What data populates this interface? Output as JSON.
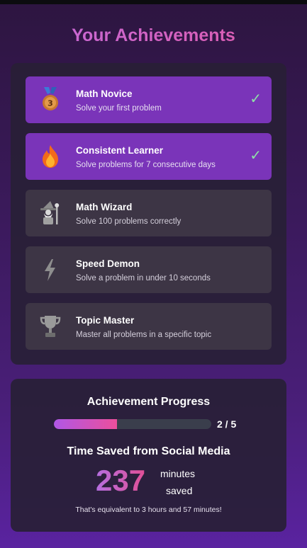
{
  "page": {
    "title": "Your Achievements"
  },
  "achievements": [
    {
      "name": "Math Novice",
      "description": "Solve your first problem",
      "icon": "medal-icon",
      "unlocked": true,
      "check": "✓"
    },
    {
      "name": "Consistent Learner",
      "description": "Solve problems for 7 consecutive days",
      "icon": "fire-icon",
      "unlocked": true,
      "check": "✓"
    },
    {
      "name": "Math Wizard",
      "description": "Solve 100 problems correctly",
      "icon": "wizard-icon",
      "unlocked": false
    },
    {
      "name": "Speed Demon",
      "description": "Solve a problem in under 10 seconds",
      "icon": "lightning-icon",
      "unlocked": false
    },
    {
      "name": "Topic Master",
      "description": "Master all problems in a specific topic",
      "icon": "trophy-icon",
      "unlocked": false
    }
  ],
  "progress": {
    "heading": "Achievement Progress",
    "completed": 2,
    "total": 5,
    "label": "2 / 5",
    "fraction": 0.4
  },
  "time_saved": {
    "heading": "Time Saved from Social Media",
    "value": "237",
    "unit_line1": "minutes",
    "unit_line2": "saved",
    "equivalent": "That's equivalent to 3 hours and 57 minutes!"
  },
  "colors": {
    "accent_purple": "#7a34b9",
    "locked_card": "#3d3545",
    "check_green": "#8fe0a8",
    "gradient_start": "#b057e6",
    "gradient_end": "#ec4f9c"
  }
}
